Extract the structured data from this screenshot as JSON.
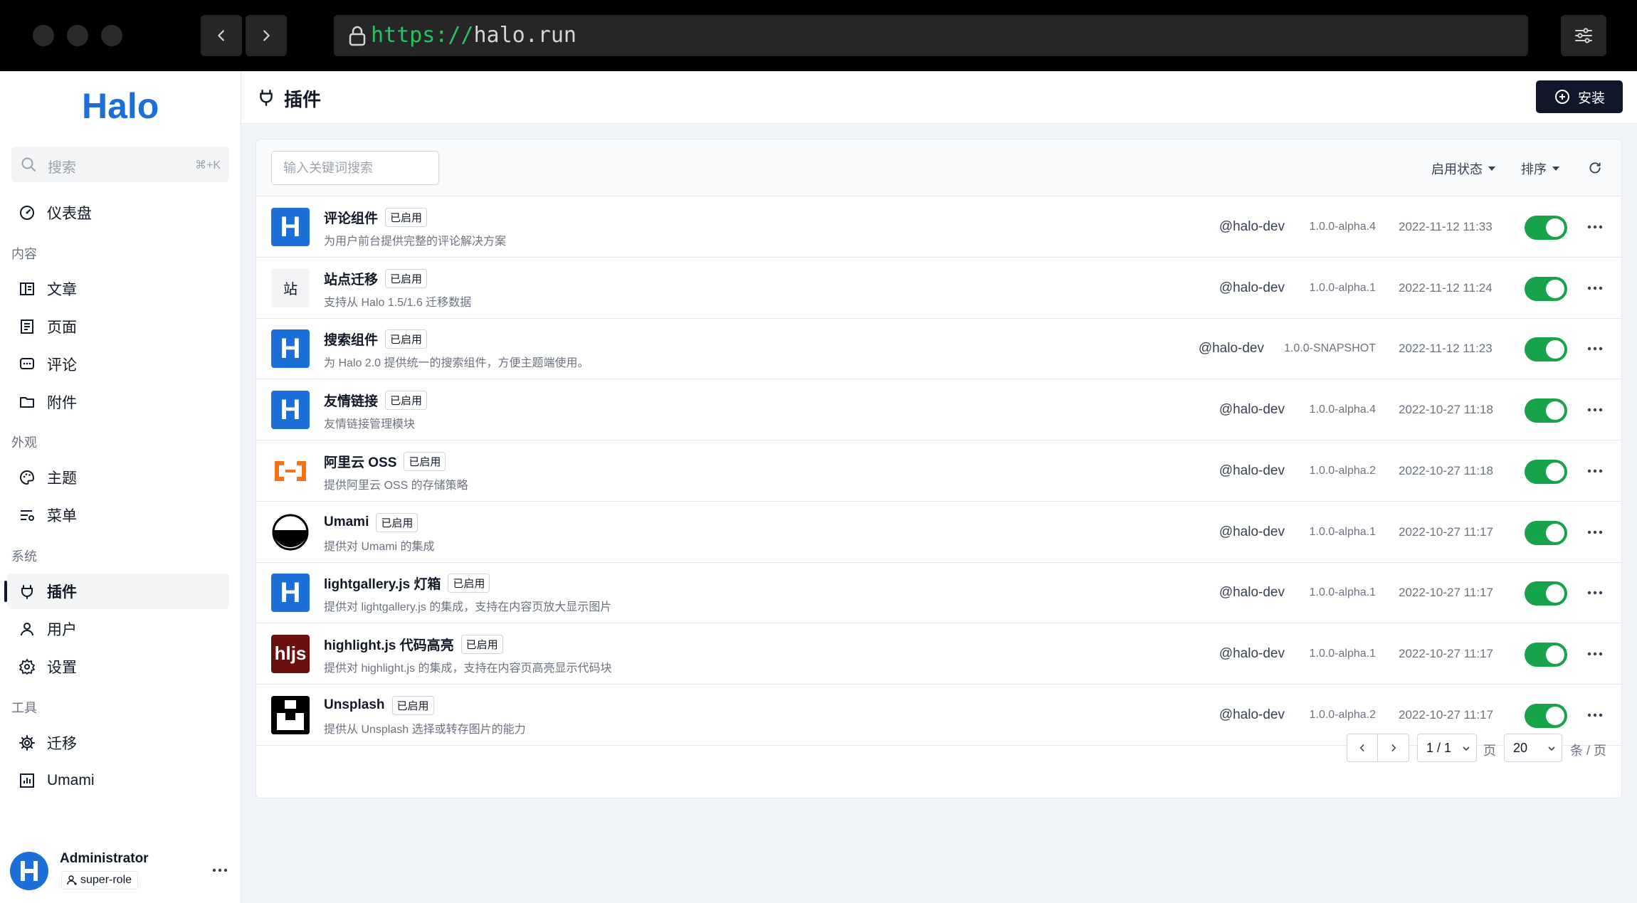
{
  "browser": {
    "url_scheme": "https://",
    "url_host": "halo.run"
  },
  "sidebar": {
    "logo_text": "Halo",
    "search_placeholder": "搜索",
    "search_shortcut": "⌘+K",
    "dashboard": "仪表盘",
    "sections": {
      "content": "内容",
      "appearance": "外观",
      "system": "系统",
      "tools": "工具"
    },
    "items": {
      "posts": "文章",
      "pages": "页面",
      "comments": "评论",
      "attachments": "附件",
      "themes": "主题",
      "menus": "菜单",
      "plugins": "插件",
      "users": "用户",
      "settings": "设置",
      "migration": "迁移",
      "umami": "Umami"
    },
    "user": {
      "name": "Administrator",
      "role": "super-role"
    }
  },
  "header": {
    "title": "插件",
    "install_label": "安装"
  },
  "toolbar": {
    "keyword_placeholder": "输入关键词搜索",
    "status_filter": "启用状态",
    "sort_filter": "排序"
  },
  "plugins": [
    {
      "name": "评论组件",
      "badge": "已启用",
      "desc": "为用户前台提供完整的评论解决方案",
      "author": "@halo-dev",
      "version": "1.0.0-alpha.4",
      "date": "2022-11-12 11:33",
      "icon": "halo-icon",
      "icon_text": "H",
      "enabled": true
    },
    {
      "name": "站点迁移",
      "badge": "已启用",
      "desc": "支持从 Halo 1.5/1.6 迁移数据",
      "author": "@halo-dev",
      "version": "1.0.0-alpha.1",
      "date": "2022-11-12 11:24",
      "icon": "zhan-icon",
      "icon_text": "站",
      "enabled": true
    },
    {
      "name": "搜索组件",
      "badge": "已启用",
      "desc": "为 Halo 2.0 提供统一的搜索组件，方便主题端使用。",
      "author": "@halo-dev",
      "version": "1.0.0-SNAPSHOT",
      "date": "2022-11-12 11:23",
      "icon": "halo-icon",
      "icon_text": "H",
      "enabled": true
    },
    {
      "name": "友情链接",
      "badge": "已启用",
      "desc": "友情链接管理模块",
      "author": "@halo-dev",
      "version": "1.0.0-alpha.4",
      "date": "2022-10-27 11:18",
      "icon": "halo-icon",
      "icon_text": "H",
      "enabled": true
    },
    {
      "name": "阿里云 OSS",
      "badge": "已启用",
      "desc": "提供阿里云 OSS 的存储策略",
      "author": "@halo-dev",
      "version": "1.0.0-alpha.2",
      "date": "2022-10-27 11:18",
      "icon": "aliyun-icon",
      "icon_text": "",
      "enabled": true
    },
    {
      "name": "Umami",
      "badge": "已启用",
      "desc": "提供对 Umami 的集成",
      "author": "@halo-dev",
      "version": "1.0.0-alpha.1",
      "date": "2022-10-27 11:17",
      "icon": "umami-icon",
      "icon_text": "",
      "enabled": true
    },
    {
      "name": "lightgallery.js 灯箱",
      "badge": "已启用",
      "desc": "提供对 lightgallery.js 的集成，支持在内容页放大显示图片",
      "author": "@halo-dev",
      "version": "1.0.0-alpha.1",
      "date": "2022-10-27 11:17",
      "icon": "halo-icon",
      "icon_text": "H",
      "enabled": true
    },
    {
      "name": "highlight.js 代码高亮",
      "badge": "已启用",
      "desc": "提供对 highlight.js 的集成，支持在内容页高亮显示代码块",
      "author": "@halo-dev",
      "version": "1.0.0-alpha.1",
      "date": "2022-10-27 11:17",
      "icon": "hljs-icon",
      "icon_text": "hljs",
      "enabled": true
    },
    {
      "name": "Unsplash",
      "badge": "已启用",
      "desc": "提供从 Unsplash 选择或转存图片的能力",
      "author": "@halo-dev",
      "version": "1.0.0-alpha.2",
      "date": "2022-10-27 11:17",
      "icon": "unsplash-icon",
      "icon_text": "",
      "enabled": true
    }
  ],
  "pagination": {
    "page_value": "1 / 1",
    "page_unit": "页",
    "size_value": "20",
    "size_unit": "条 / 页"
  },
  "colors": {
    "accent": "#0f172a",
    "toggle_on": "#16a34a",
    "halo_blue": "#1b6fd6",
    "url_scheme": "#22c55e"
  }
}
